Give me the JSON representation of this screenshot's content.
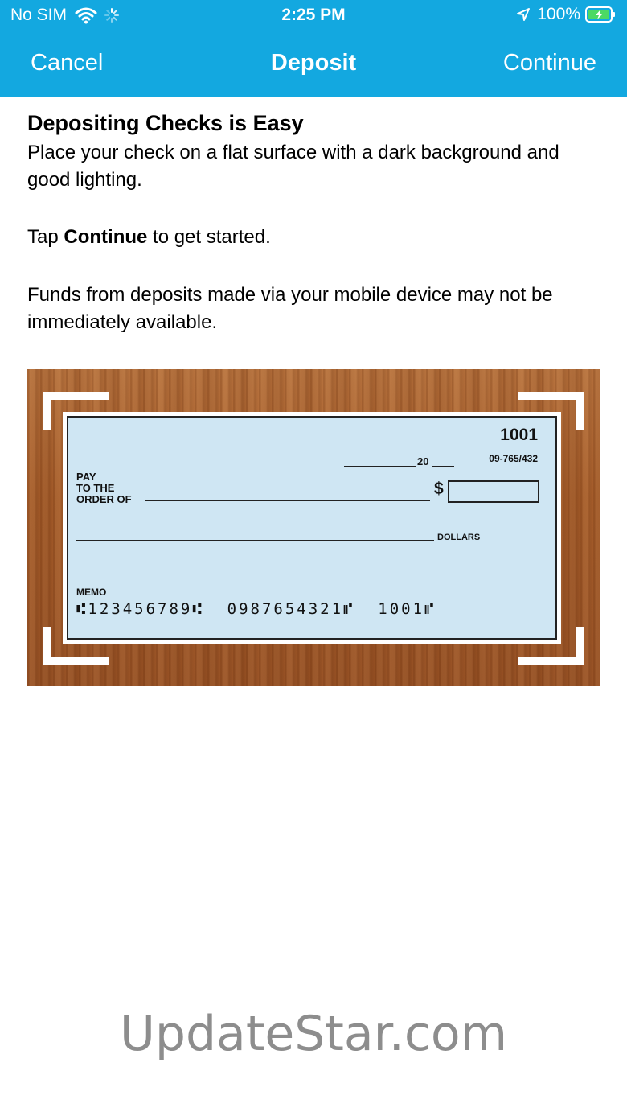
{
  "status_bar": {
    "carrier": "No SIM",
    "time": "2:25 PM",
    "battery": "100%"
  },
  "nav": {
    "cancel_label": "Cancel",
    "title": "Deposit",
    "continue_label": "Continue"
  },
  "instructions": {
    "heading": "Depositing Checks is Easy",
    "line1": "Place your check on a flat surface with a dark background and good lighting.",
    "tap_prefix": "Tap ",
    "tap_bold": "Continue",
    "tap_suffix": " to get started.",
    "line3": "Funds from deposits made via your mobile device may not be immediately available."
  },
  "check": {
    "number": "1001",
    "routing": "09-765/432",
    "date_label": "20",
    "pay_label_1": "PAY",
    "pay_label_2": "TO THE",
    "pay_label_3": "ORDER OF",
    "dollar_sign": "$",
    "dollars_label": "DOLLARS",
    "memo_label": "MEMO",
    "micr": "⑆123456789⑆  0987654321⑈  1001⑈"
  },
  "watermark": "UpdateStar.com",
  "colors": {
    "accent": "#13a8e0",
    "check_background": "#cfe6f3",
    "battery": "#4cd964"
  },
  "icons": [
    "wifi-icon",
    "loading-spinner-icon",
    "location-arrow-icon",
    "battery-icon"
  ]
}
